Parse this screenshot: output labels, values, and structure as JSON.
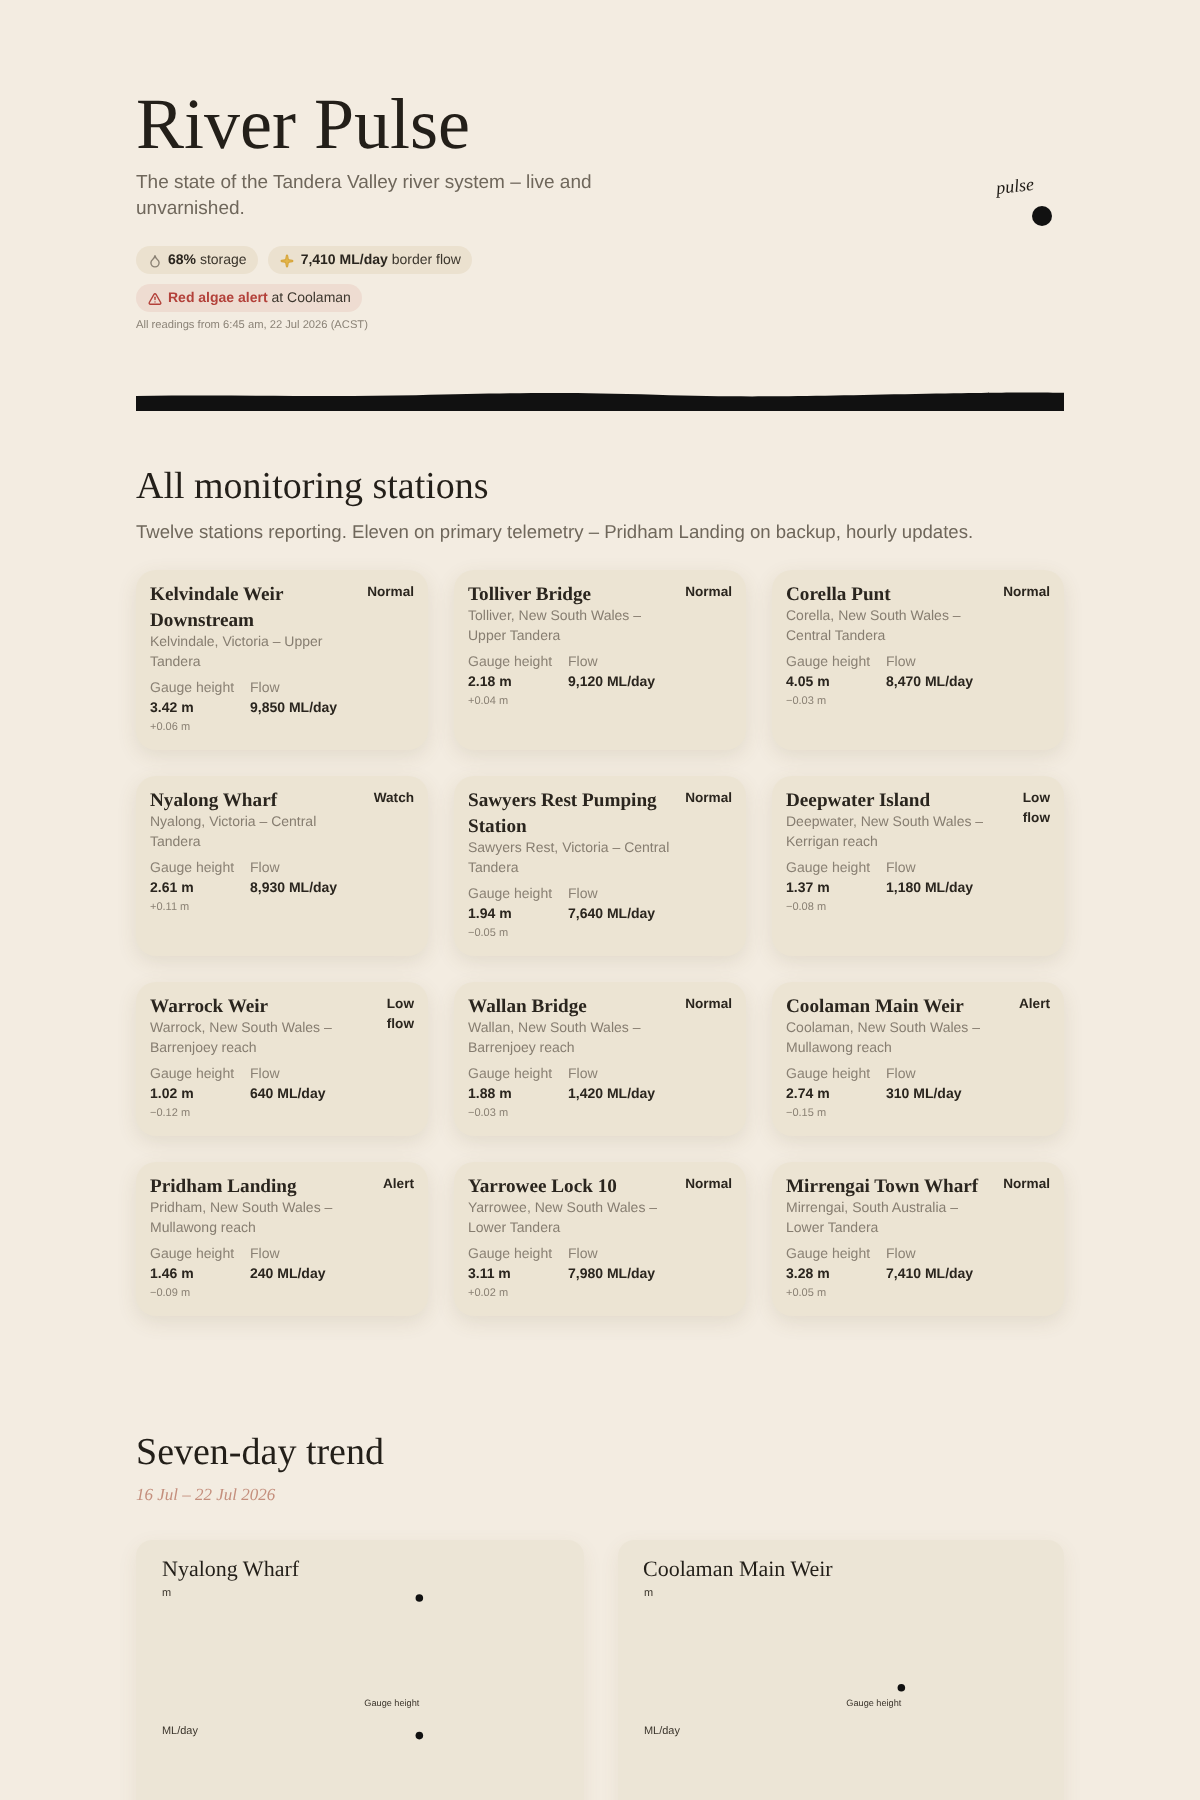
{
  "header": {
    "title": "River Pulse",
    "subtitle": "The state of the Tandera Valley river system – live and unvarnished.",
    "chips": [
      {
        "kind": "storage",
        "text": "**68%** storage"
      },
      {
        "kind": "flow",
        "text": "**7,410 ML/day** border flow"
      }
    ],
    "alert": {
      "text": "**Red algae alert** at Coolaman"
    },
    "timestamp": "All readings from 6:45 am, 22 Jul 2026 (ACST)",
    "pulse_label": "pulse"
  },
  "stations_section": {
    "title": "All monitoring stations",
    "subtitle": "Twelve stations reporting. Eleven on primary telemetry – Pridham Landing on backup, hourly updates.",
    "stations": [
      {
        "name": "Kelvindale Weir Downstream",
        "status": "Normal",
        "location": "Kelvindale, Victoria – Upper Tandera",
        "gauge_label": "Gauge height",
        "gauge": "3.42 m",
        "flow_label": "Flow",
        "flow": "9,850 ML/day",
        "change": "+0.06 m"
      },
      {
        "name": "Tolliver Bridge",
        "status": "Normal",
        "location": "Tolliver, New South Wales – Upper Tandera",
        "gauge_label": "Gauge height",
        "gauge": "2.18 m",
        "flow_label": "Flow",
        "flow": "9,120 ML/day",
        "change": "+0.04 m"
      },
      {
        "name": "Corella Punt",
        "status": "Normal",
        "location": "Corella, New South Wales – Central Tandera",
        "gauge_label": "Gauge height",
        "gauge": "4.05 m",
        "flow_label": "Flow",
        "flow": "8,470 ML/day",
        "change": "−0.03 m"
      },
      {
        "name": "Nyalong Wharf",
        "status": "Watch",
        "location": "Nyalong, Victoria – Central Tandera",
        "gauge_label": "Gauge height",
        "gauge": "2.61 m",
        "flow_label": "Flow",
        "flow": "8,930 ML/day",
        "change": "+0.11 m"
      },
      {
        "name": "Sawyers Rest Pumping Station",
        "status": "Normal",
        "location": "Sawyers Rest, Victoria – Central Tandera",
        "gauge_label": "Gauge height",
        "gauge": "1.94 m",
        "flow_label": "Flow",
        "flow": "7,640 ML/day",
        "change": "−0.05 m"
      },
      {
        "name": "Deepwater Island",
        "status": "Low flow",
        "location": "Deepwater, New South Wales – Kerrigan reach",
        "gauge_label": "Gauge height",
        "gauge": "1.37 m",
        "flow_label": "Flow",
        "flow": "1,180 ML/day",
        "change": "−0.08 m"
      },
      {
        "name": "Warrock Weir",
        "status": "Low flow",
        "location": "Warrock, New South Wales – Barrenjoey reach",
        "gauge_label": "Gauge height",
        "gauge": "1.02 m",
        "flow_label": "Flow",
        "flow": "640 ML/day",
        "change": "−0.12 m"
      },
      {
        "name": "Wallan Bridge",
        "status": "Normal",
        "location": "Wallan, New South Wales – Barrenjoey reach",
        "gauge_label": "Gauge height",
        "gauge": "1.88 m",
        "flow_label": "Flow",
        "flow": "1,420 ML/day",
        "change": "−0.03 m"
      },
      {
        "name": "Coolaman Main Weir",
        "status": "Alert",
        "location": "Coolaman, New South Wales – Mullawong reach",
        "gauge_label": "Gauge height",
        "gauge": "2.74 m",
        "flow_label": "Flow",
        "flow": "310 ML/day",
        "change": "−0.15 m"
      },
      {
        "name": "Pridham Landing",
        "status": "Alert",
        "location": "Pridham, New South Wales – Mullawong reach",
        "gauge_label": "Gauge height",
        "gauge": "1.46 m",
        "flow_label": "Flow",
        "flow": "240 ML/day",
        "change": "−0.09 m"
      },
      {
        "name": "Yarrowee Lock 10",
        "status": "Normal",
        "location": "Yarrowee, New South Wales – Lower Tandera",
        "gauge_label": "Gauge height",
        "gauge": "3.11 m",
        "flow_label": "Flow",
        "flow": "7,980 ML/day",
        "change": "+0.02 m"
      },
      {
        "name": "Mirrengai Town Wharf",
        "status": "Normal",
        "location": "Mirrengai, South Australia – Lower Tandera",
        "gauge_label": "Gauge height",
        "gauge": "3.28 m",
        "flow_label": "Flow",
        "flow": "7,410 ML/day",
        "change": "+0.05 m"
      }
    ]
  },
  "trend_section": {
    "title": "Seven-day trend",
    "date_range": "16 Jul – 22 Jul 2026",
    "charts": [
      {
        "title": "Nyalong Wharf",
        "unit_top": "m",
        "series_label": "Gauge height",
        "unit_bottom": "ML/day",
        "markers": [
          {
            "kind": "upper"
          },
          {
            "kind": "lower"
          }
        ]
      },
      {
        "title": "Coolaman Main Weir",
        "unit_top": "m",
        "series_label": "Gauge height",
        "unit_bottom": "ML/day",
        "markers": [
          {
            "kind": "middle"
          }
        ]
      }
    ]
  }
}
